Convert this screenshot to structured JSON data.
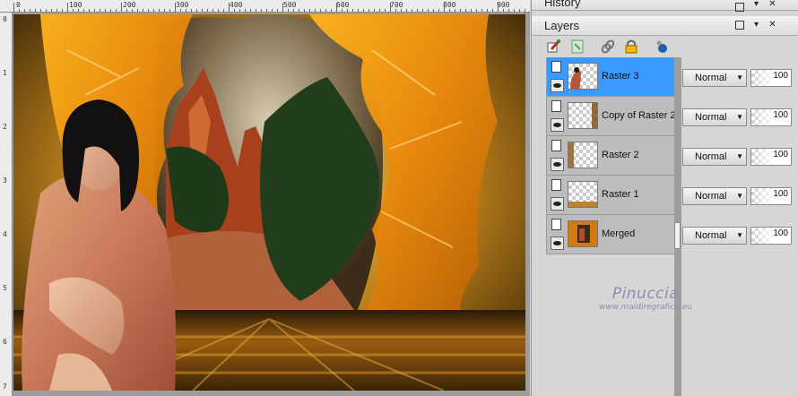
{
  "ruler": {
    "top_labels": [
      "0",
      "100",
      "200",
      "300",
      "400",
      "500",
      "600",
      "700",
      "800",
      "900"
    ],
    "left_labels": [
      "0",
      "1",
      "2",
      "3",
      "4",
      "5",
      "6",
      "7"
    ]
  },
  "history_panel": {
    "title": "History"
  },
  "layers_panel": {
    "title": "Layers",
    "toolbar": [
      "new-raster-icon",
      "new-mask-icon",
      "link-icon",
      "lock-icon",
      "effects-icon"
    ],
    "layers": [
      {
        "name": "Raster 3",
        "selected": true,
        "blend": "Normal",
        "opacity": "100"
      },
      {
        "name": "Copy of Raster 2",
        "selected": false,
        "blend": "Normal",
        "opacity": "100"
      },
      {
        "name": "Raster 2",
        "selected": false,
        "blend": "Normal",
        "opacity": "100"
      },
      {
        "name": "Raster 1",
        "selected": false,
        "blend": "Normal",
        "opacity": "100"
      },
      {
        "name": "Merged",
        "selected": false,
        "blend": "Normal",
        "opacity": "100"
      }
    ]
  },
  "watermark": {
    "name": "Pinuccia",
    "url": "www.maidiregrafica.eu"
  },
  "colors": {
    "selected_layer": "#3b9aff",
    "panel_bg": "#d6d6d6",
    "accent_orange": "#e8940f"
  }
}
